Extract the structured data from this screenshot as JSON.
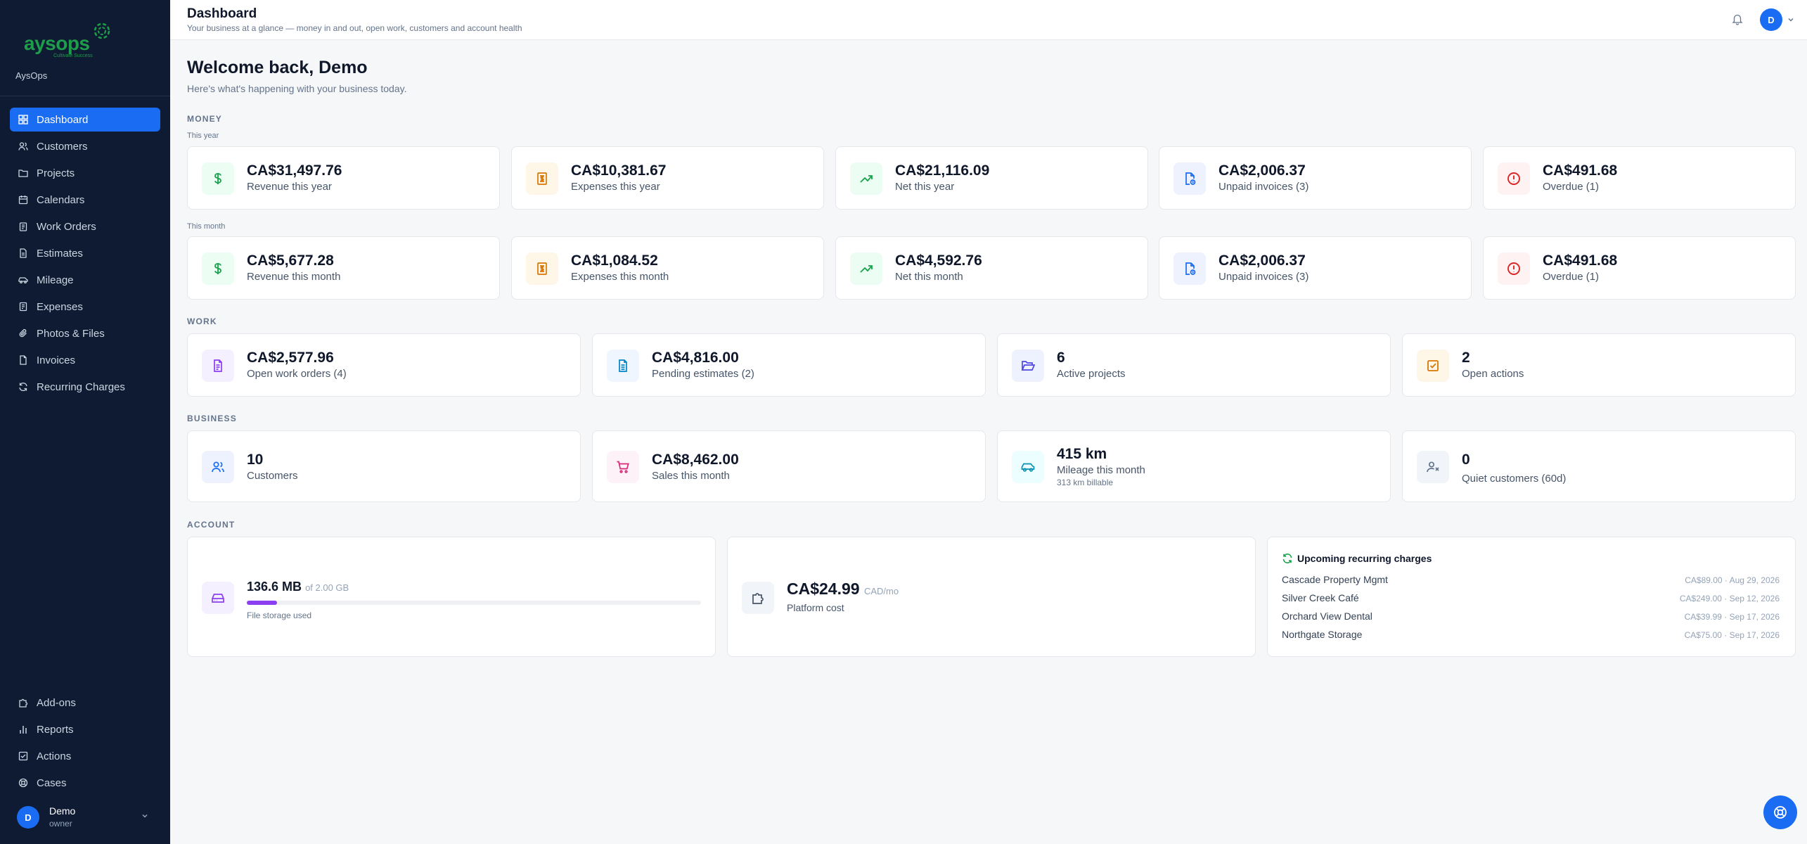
{
  "brand": {
    "logo_text": "aysops",
    "logo_tagline": "Cultivate Success",
    "org_name": "AysOps",
    "color": "#1e9e4a"
  },
  "sidebar": {
    "items": [
      {
        "label": "Dashboard",
        "icon": "dashboard-icon",
        "active": true
      },
      {
        "label": "Customers",
        "icon": "users-icon"
      },
      {
        "label": "Projects",
        "icon": "folder-icon"
      },
      {
        "label": "Calendars",
        "icon": "calendar-icon"
      },
      {
        "label": "Work Orders",
        "icon": "clipboard-icon"
      },
      {
        "label": "Estimates",
        "icon": "document-icon"
      },
      {
        "label": "Mileage",
        "icon": "car-icon"
      },
      {
        "label": "Expenses",
        "icon": "receipt-icon"
      },
      {
        "label": "Photos & Files",
        "icon": "paperclip-icon"
      },
      {
        "label": "Invoices",
        "icon": "file-icon"
      },
      {
        "label": "Recurring Charges",
        "icon": "refresh-icon"
      }
    ],
    "bottom_items": [
      {
        "label": "Add-ons",
        "icon": "puzzle-icon"
      },
      {
        "label": "Reports",
        "icon": "bar-chart-icon"
      },
      {
        "label": "Actions",
        "icon": "check-square-icon"
      },
      {
        "label": "Cases",
        "icon": "lifebuoy-icon"
      }
    ],
    "user": {
      "initial": "D",
      "name": "Demo",
      "role": "owner"
    }
  },
  "header": {
    "title": "Dashboard",
    "subtitle": "Your business at a glance — money in and out, open work, customers and account health",
    "avatar_initial": "D"
  },
  "main": {
    "welcome": "Welcome back, Demo",
    "welcome_sub": "Here's what's happening with your business today.",
    "money": {
      "section": "MONEY",
      "year_label": "This year",
      "month_label": "This month",
      "year": [
        {
          "value": "CA$31,497.76",
          "label": "Revenue this year",
          "icon": "dollar-icon"
        },
        {
          "value": "CA$10,381.67",
          "label": "Expenses this year",
          "icon": "receipt-icon"
        },
        {
          "value": "CA$21,116.09",
          "label": "Net this year",
          "icon": "trending-up-icon"
        },
        {
          "value": "CA$2,006.37",
          "label": "Unpaid invoices (3)",
          "icon": "file-clock-icon"
        },
        {
          "value": "CA$491.68",
          "label": "Overdue (1)",
          "icon": "alert-circle-icon"
        }
      ],
      "month": [
        {
          "value": "CA$5,677.28",
          "label": "Revenue this month",
          "icon": "dollar-icon"
        },
        {
          "value": "CA$1,084.52",
          "label": "Expenses this month",
          "icon": "receipt-icon"
        },
        {
          "value": "CA$4,592.76",
          "label": "Net this month",
          "icon": "trending-up-icon"
        },
        {
          "value": "CA$2,006.37",
          "label": "Unpaid invoices (3)",
          "icon": "file-clock-icon"
        },
        {
          "value": "CA$491.68",
          "label": "Overdue (1)",
          "icon": "alert-circle-icon"
        }
      ]
    },
    "work": {
      "section": "WORK",
      "cards": [
        {
          "value": "CA$2,577.96",
          "label": "Open work orders (4)",
          "icon": "clipboard-icon"
        },
        {
          "value": "CA$4,816.00",
          "label": "Pending estimates (2)",
          "icon": "document-icon"
        },
        {
          "value": "6",
          "label": "Active projects",
          "icon": "folder-open-icon"
        },
        {
          "value": "2",
          "label": "Open actions",
          "icon": "check-square-icon"
        }
      ]
    },
    "business": {
      "section": "BUSINESS",
      "cards": [
        {
          "value": "10",
          "label": "Customers",
          "icon": "users-icon"
        },
        {
          "value": "CA$8,462.00",
          "label": "Sales this month",
          "icon": "cart-icon"
        },
        {
          "value": "415 km",
          "label": "Mileage this month",
          "sub": "313 km billable",
          "icon": "car-icon"
        },
        {
          "value": "0",
          "label": "Quiet customers (60d)",
          "icon": "user-x-icon"
        }
      ]
    },
    "account": {
      "section": "ACCOUNT",
      "storage": {
        "value": "136.6 MB",
        "of": "of 2.00 GB",
        "label": "File storage used",
        "used_fraction": 0.067,
        "icon": "hard-drive-icon"
      },
      "platform": {
        "value": "CA$24.99",
        "unit": "CAD/mo",
        "label": "Platform cost",
        "icon": "puzzle-icon"
      },
      "recurring": {
        "title": "Upcoming recurring charges",
        "icon": "refresh-icon",
        "rows": [
          {
            "name": "Cascade Property Mgmt",
            "meta": "CA$89.00 · Aug 29, 2026"
          },
          {
            "name": "Silver Creek Café",
            "meta": "CA$249.00 · Sep 12, 2026"
          },
          {
            "name": "Orchard View Dental",
            "meta": "CA$39.99 · Sep 17, 2026"
          },
          {
            "name": "Northgate Storage",
            "meta": "CA$75.00 · Sep 17, 2026"
          }
        ]
      }
    }
  },
  "colors": {
    "accent": "#1a6cf2",
    "sidebar_bg": "#0f1b33",
    "storage_bar": "#8b3ff0"
  }
}
